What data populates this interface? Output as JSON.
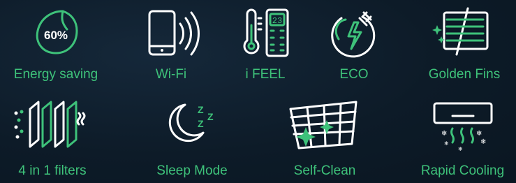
{
  "features": [
    {
      "label": "Energy saving",
      "icon": "leaf-percent-icon",
      "badge": "60%"
    },
    {
      "label": "Wi-Fi",
      "icon": "smartphone-wifi-icon"
    },
    {
      "label": "i FEEL",
      "icon": "thermometer-remote-icon",
      "display": "23"
    },
    {
      "label": "ECO",
      "icon": "eco-plug-icon"
    },
    {
      "label": "Golden Fins",
      "icon": "golden-fins-icon"
    },
    {
      "label": "4 in 1 filters",
      "icon": "filter-layers-icon"
    },
    {
      "label": "Sleep Mode",
      "icon": "moon-sleep-icon",
      "sleep_text": "Z"
    },
    {
      "label": "Self-Clean",
      "icon": "self-clean-grid-icon"
    },
    {
      "label": "Rapid Cooling",
      "icon": "ac-snowflake-icon"
    }
  ],
  "colors": {
    "accent": "#3ec27a",
    "icon": "#ffffff",
    "background": "#0d1b28"
  }
}
